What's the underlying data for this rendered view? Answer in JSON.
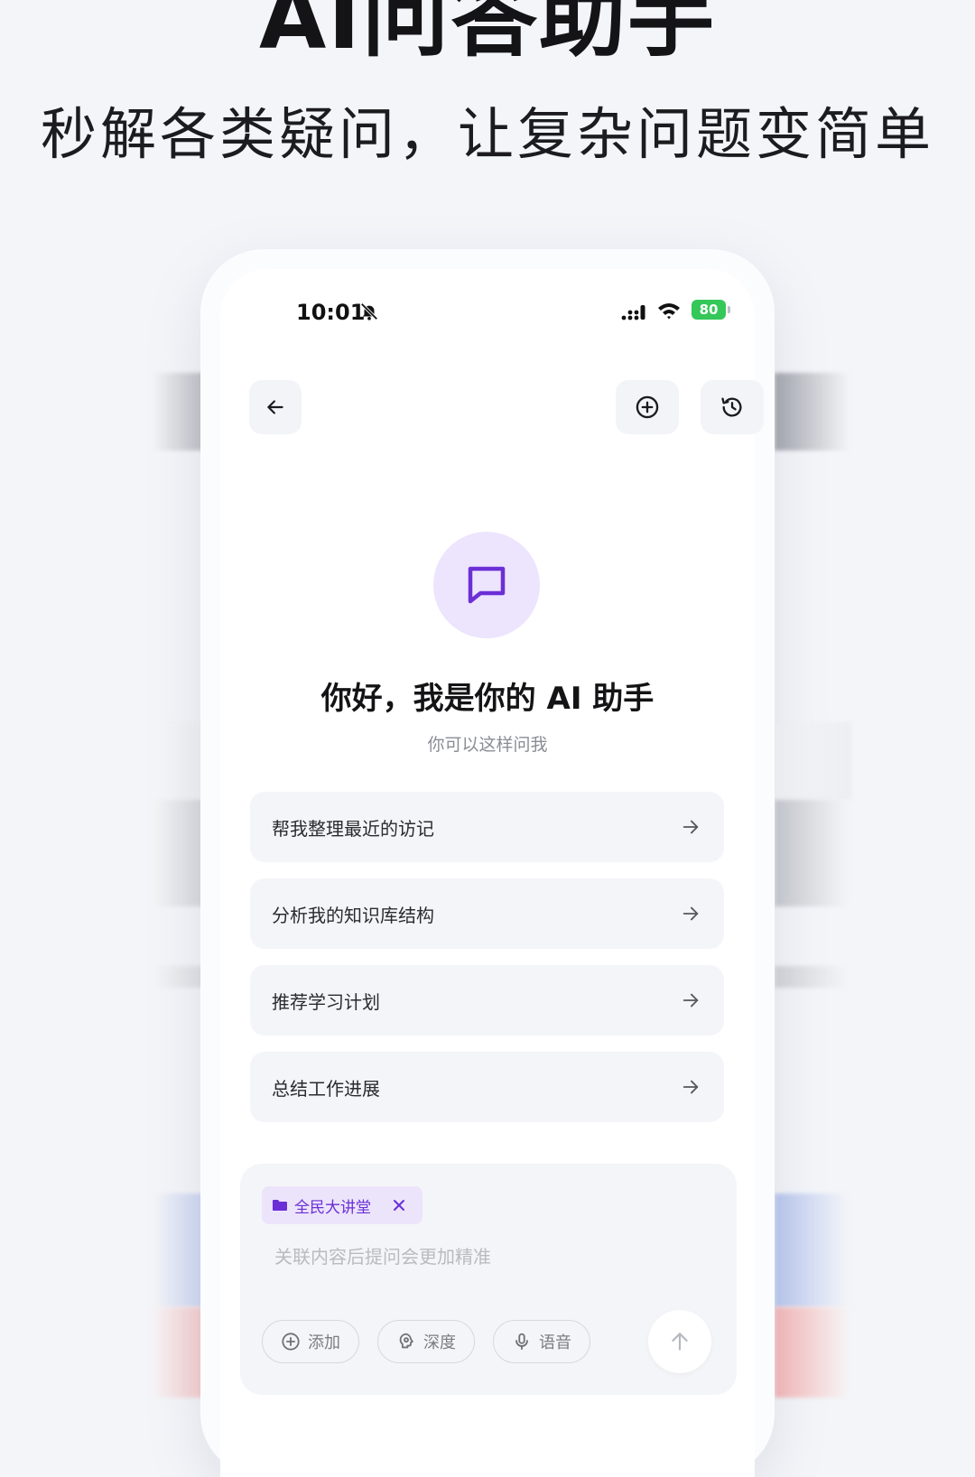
{
  "hero": {
    "title": "AI问答助手",
    "subtitle": "秒解各类疑问，让复杂问题变简单"
  },
  "status_bar": {
    "time": "10:01",
    "battery": "80"
  },
  "header": {
    "back_icon": "arrow-left-icon",
    "new_chat_icon": "plus-circle-icon",
    "history_icon": "history-icon"
  },
  "welcome": {
    "icon": "message-square-icon",
    "greeting": "你好，我是你的 AI 助手",
    "hint": "你可以这样问我"
  },
  "suggestions": [
    {
      "label": "帮我整理最近的访记"
    },
    {
      "label": "分析我的知识库结构"
    },
    {
      "label": "推荐学习计划"
    },
    {
      "label": "总结工作进展"
    }
  ],
  "composer": {
    "context_chip": "全民大讲堂",
    "placeholder": "关联内容后提问会更加精准",
    "add_label": "添加",
    "deep_label": "深度",
    "voice_label": "语音"
  },
  "colors": {
    "accent": "#6b2fd6",
    "avatar_bg": "#ede4fd",
    "battery": "#34c759"
  }
}
